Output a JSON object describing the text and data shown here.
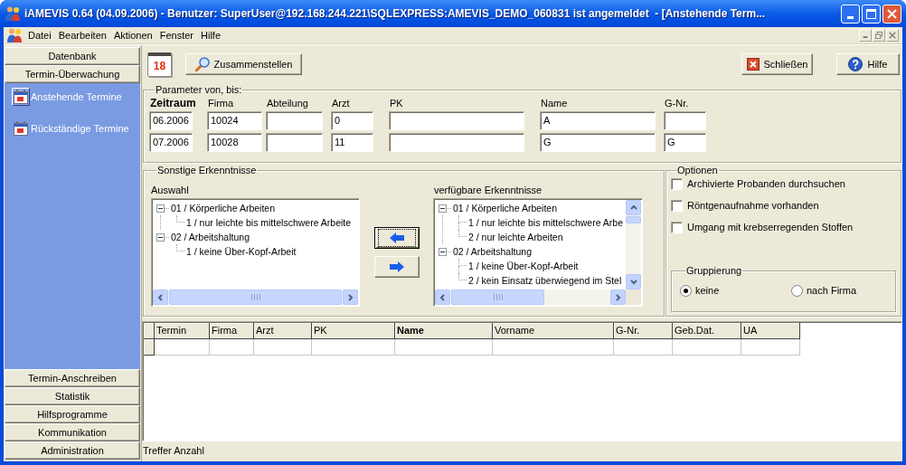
{
  "window": {
    "title": "iAMEVIS 0.64 (04.09.2006) - Benutzer: SuperUser@192.168.244.221\\SQLEXPRESS:AMEVIS_DEMO_060831 ist angemeldet  - [Anstehende Term..."
  },
  "menu": [
    "Datei",
    "Bearbeiten",
    "Aktionen",
    "Fenster",
    "Hilfe"
  ],
  "sidebar": {
    "sections": [
      {
        "label": "Datenbank",
        "expanded": false
      },
      {
        "label": "Termin-Überwachung",
        "expanded": true,
        "items": [
          {
            "label": "Anstehende Termine",
            "selected": true
          },
          {
            "label": "Rückständige Termine",
            "selected": false
          }
        ]
      },
      {
        "label": "Termin-Anschreiben",
        "expanded": false
      },
      {
        "label": "Statistik",
        "expanded": false
      },
      {
        "label": "Hilfsprogramme",
        "expanded": false
      },
      {
        "label": "Kommunikation",
        "expanded": false
      },
      {
        "label": "Administration",
        "expanded": false
      }
    ]
  },
  "toolbar": {
    "calendar_day": "18",
    "buttons": [
      {
        "kind": "search",
        "label": "Zusammenstellen"
      },
      {
        "kind": "close",
        "label": "Schließen"
      },
      {
        "kind": "help",
        "label": "Hilfe"
      }
    ]
  },
  "parameters": {
    "title": "Parameter von, bis:",
    "fields": [
      {
        "label": "Zeitraum",
        "bold": true,
        "from": "06.2006",
        "to": "07.2006"
      },
      {
        "label": "Firma",
        "bold": false,
        "from": "10024",
        "to": "10028"
      },
      {
        "label": "Abteilung",
        "bold": false
      },
      {
        "label": "Arzt",
        "bold": false,
        "from": "0",
        "to": "11"
      },
      {
        "label": "PK",
        "bold": false
      },
      {
        "label": "Name",
        "bold": false,
        "from": "A",
        "to": "G"
      },
      {
        "label": "G-Nr.",
        "bold": false,
        "to": "G"
      }
    ]
  },
  "findings": {
    "title": "Sonstige Erkenntnisse",
    "selection": {
      "label": "Auswahl",
      "tree": [
        {
          "label": "01 / Körperliche Arbeiten",
          "expanded": true,
          "children": [
            {
              "label": "1 / nur leichte bis mittelschwere Arbeite"
            }
          ]
        },
        {
          "label": "02 / Arbeitshaltung",
          "expanded": true,
          "children": [
            {
              "label": "1 / keine Über-Kopf-Arbeit"
            }
          ]
        }
      ]
    },
    "transfer_buttons": [
      {
        "kind": "left",
        "focused": true
      },
      {
        "kind": "right",
        "focused": false
      }
    ],
    "available": {
      "label": "verfügbare Erkenntnisse",
      "tree": [
        {
          "label": "01 / Körperliche Arbeiten",
          "expanded": true,
          "children": [
            {
              "label": "1 / nur leichte bis mittelschwere Arbe"
            },
            {
              "label": "2 / nur leichte Arbeiten"
            }
          ]
        },
        {
          "label": "02 / Arbeitshaltung",
          "expanded": true,
          "children": [
            {
              "label": "1 / keine Über-Kopf-Arbeit"
            },
            {
              "label": "2 / kein Einsatz überwiegend im Stel"
            }
          ]
        }
      ]
    }
  },
  "options": {
    "title": "Optionen",
    "checkboxes": [
      {
        "label": "Archivierte Probanden durchsuchen",
        "checked": false
      },
      {
        "label": "Röntgenaufnahme vorhanden",
        "checked": false
      },
      {
        "label": "Umgang mit krebserregenden Stoffen",
        "checked": false
      }
    ],
    "grouping": {
      "title": "Gruppierung",
      "choices": [
        {
          "label": "keine",
          "selected": true
        },
        {
          "label": "nach Firma",
          "selected": false
        }
      ]
    }
  },
  "table": {
    "columns": [
      {
        "label": "Termin",
        "bold": false
      },
      {
        "label": "Firma",
        "bold": false
      },
      {
        "label": "Arzt",
        "bold": false
      },
      {
        "label": "PK",
        "bold": false
      },
      {
        "label": "Name",
        "bold": true
      },
      {
        "label": "Vorname",
        "bold": false
      },
      {
        "label": "G-Nr.",
        "bold": false
      },
      {
        "label": "Geb.Dat.",
        "bold": false
      },
      {
        "label": "UA",
        "bold": false
      }
    ]
  },
  "status_bar": {
    "text": "Treffer Anzahl"
  }
}
